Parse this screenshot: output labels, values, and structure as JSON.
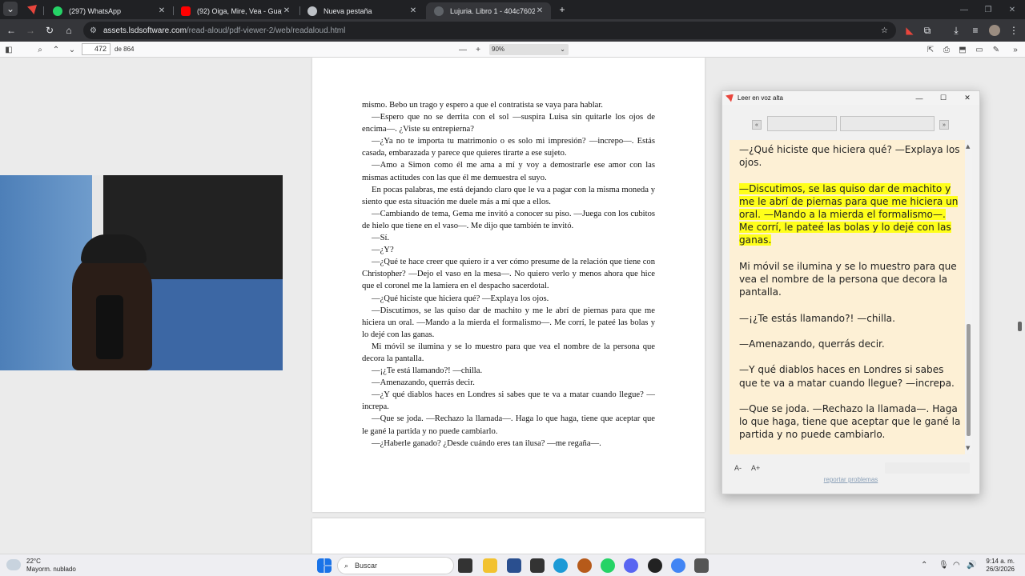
{
  "tabs": [
    {
      "label": "(297) WhatsApp",
      "icon": "whatsapp-icon",
      "color": "#25d366"
    },
    {
      "label": "(92) Oiga, Mire, Vea - Guayacán",
      "icon": "youtube-icon",
      "color": "#ff0000"
    },
    {
      "label": "Nueva pestaña",
      "icon": "chrome-icon",
      "color": "#bdc1c6"
    },
    {
      "label": "Lujuria. Libro 1 - 404c7602-daa",
      "icon": "pdf-icon",
      "color": "#5f6368"
    }
  ],
  "address": {
    "host": "assets.lsdsoftware.com",
    "path": "/read-aloud/pdf-viewer-2/web/readaloud.html"
  },
  "pdf": {
    "page_number": "472",
    "page_total": "de 864",
    "zoom": "90%"
  },
  "page_text": [
    "mismo. Bebo un trago y espero a que el contratista se vaya para hablar.",
    "—Espero que no se derrita con el sol —suspira Luisa sin quitarle los ojos de encima—. ¿Viste su entrepierna?",
    "—¿Ya no te importa tu matrimonio o es solo mi impresión? —increpo—. Estás casada, embarazada y parece que quieres tirarte a ese sujeto.",
    "—Amo a Simon como él me ama a mí y voy a demostrarle ese amor con las mismas actitudes con las que él me demuestra el suyo.",
    "En pocas palabras, me está dejando claro que le va a pagar con la misma moneda y siento que esta situación me duele más a mí que a ellos.",
    "—Cambiando de tema, Gema me invitó a conocer su piso. —Juega con los cubitos de hielo que tiene en el vaso—. Me dijo que también te invitó.",
    "—Sí.",
    "—¿Y?",
    "—¿Qué te hace creer que quiero ir a ver cómo presume de la relación que tiene con Christopher? —Dejo el vaso en la mesa—. No quiero verlo y menos ahora que hice que el coronel me la lamiera en el despacho sacerdotal.",
    "—¿Qué hiciste que hiciera qué? —Explaya los ojos.",
    "—Discutimos, se las quiso dar de machito y me le abrí de piernas para que me hiciera un oral. —Mando a la mierda el formalismo—. Me corrí, le pateé las bolas y lo dejé con las ganas.",
    "Mi móvil se ilumina y se lo muestro para que vea el nombre de la persona que decora la pantalla.",
    "—¡¿Te está llamando?! —chilla.",
    "—Amenazando, querrás decir.",
    "—¿Y qué diablos haces en Londres si sabes que te va a matar cuando llegue? —increpa.",
    "—Que se joda. —Rechazo la llamada—. Haga lo que haga, tiene que aceptar que le gané la partida y no puede cambiarlo.",
    "—¿Haberle ganado? ¿Desde cuándo eres tan ilusa? —me regaña—."
  ],
  "read_aloud": {
    "title": "Leer en voz alta",
    "paragraphs": [
      {
        "text": "—¿Qué hiciste que hiciera qué? —Explaya los ojos.",
        "highlight": false
      },
      {
        "text": "—Discutimos, se las quiso dar de machito y me le abrí de piernas para que me hiciera un oral. —Mando a la mierda el formalismo—. Me corrí, le pateé las bolas y lo dejé con las ganas.",
        "highlight": true
      },
      {
        "text": "Mi móvil se ilumina y se lo muestro para que vea el nombre de la persona que decora la pantalla.",
        "highlight": false
      },
      {
        "text": "—¡¿Te estás llamando?! —chilla.",
        "highlight": false
      },
      {
        "text": "—Amenazando, querrás decir.",
        "highlight": false
      },
      {
        "text": "—Y qué diablos haces en Londres si sabes que te va a matar cuando llegue? —increpa.",
        "highlight": false
      },
      {
        "text": "—Que se joda. —Rechazo la llamada—. Haga lo que haga, tiene que aceptar que le gané la partida y no puede cambiarlo.",
        "highlight": false
      }
    ],
    "font_decrease": "A-",
    "font_increase": "A+",
    "report_link": "reportar problemas",
    "highlight_color": "#ffff1a",
    "background_color": "#fdf0d5"
  },
  "taskbar": {
    "weather_temp": "22°C",
    "weather_desc": "Mayorm. nublado",
    "search_placeholder": "Buscar",
    "time": "9:14 a. m.",
    "date": "26/3/2026"
  }
}
